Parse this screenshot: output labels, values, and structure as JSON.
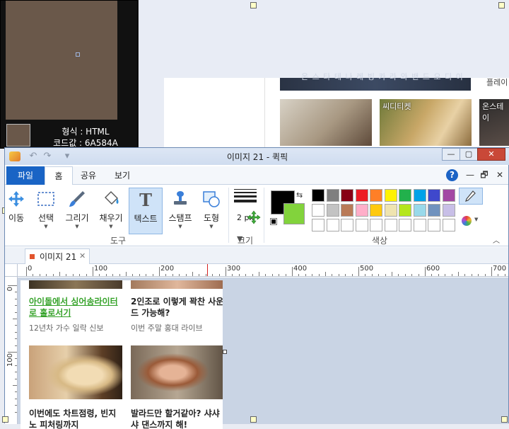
{
  "background": {
    "banner_text": "온 스 타 테 나 레 빙 카 라 와 밴 드 오 디 이",
    "side_text": "플레이",
    "photo2_tag": "씨디티켓",
    "photo3_tag": "온스테이"
  },
  "picker": {
    "format_line": "형식 : HTML",
    "code_line": "코드값 : 6A584A",
    "color": "#6A584A"
  },
  "window": {
    "title": "이미지 21 - 퀵픽",
    "minimize": "—",
    "maximize": "▢",
    "close": "✕",
    "qa_undo": "↶",
    "qa_redo": "↷",
    "qa_more": "▾"
  },
  "ribbon_tabs": {
    "file": "파일",
    "home": "홈",
    "share": "공유",
    "view": "보기",
    "help": "?",
    "collapse": "—",
    "restore": "🗗",
    "close": "✕"
  },
  "tools": [
    {
      "label": "이동",
      "icon": "move-icon"
    },
    {
      "label": "선택",
      "icon": "select-icon"
    },
    {
      "label": "그리기",
      "icon": "brush-icon"
    },
    {
      "label": "채우기",
      "icon": "fill-bucket-icon"
    },
    {
      "label": "텍스트",
      "icon": "text-icon"
    },
    {
      "label": "스탬프",
      "icon": "stamp-icon"
    },
    {
      "label": "도형",
      "icon": "shape-icon"
    }
  ],
  "groups": {
    "tools": "도구",
    "size": "크기",
    "colors": "색상"
  },
  "size": {
    "value": "2 px"
  },
  "colors": {
    "primary": "#000000",
    "secondary": "#82D33C",
    "palette_row1": [
      "#000000",
      "#7F7F7F",
      "#880015",
      "#ED1C24",
      "#FF7F27",
      "#FFF200",
      "#22B14C",
      "#00A2E8",
      "#3F48CC",
      "#A349A4"
    ],
    "palette_row2": [
      "#FFFFFF",
      "#C3C3C3",
      "#B97A57",
      "#FFAEC9",
      "#FFC90E",
      "#EFE4B0",
      "#B5E61D",
      "#99D9EA",
      "#7092BE",
      "#C8BFE7"
    ],
    "palette_row3": [
      "#FFFFFF",
      "#FFFFFF",
      "#FFFFFF",
      "#FFFFFF",
      "#FFFFFF",
      "#FFFFFF",
      "#FFFFFF",
      "#FFFFFF",
      "#FFFFFF",
      "#FFFFFF"
    ]
  },
  "document": {
    "tab_title": "이미지 21",
    "tab_close": "✕"
  },
  "ruler": {
    "top_labels": [
      "0",
      "100",
      "200",
      "300",
      "400",
      "500",
      "600",
      "700"
    ],
    "left_labels": [
      "0",
      "100"
    ]
  },
  "canvas": {
    "card1_title": "아이돌에서 싱어송라이터로 홀로서기",
    "card1_sub": "12년차 가수 일락 신보",
    "card2_title": "2인조로 이렇게 꽉찬 사운드 가능해?",
    "card2_sub": "이번 주말 홍대 라이브",
    "card3_title": "이번에도 차트점령, 빈지노 피처링까지",
    "card4_title": "발라드만 할거같아? 샤샤샤 댄스까지 해!"
  }
}
